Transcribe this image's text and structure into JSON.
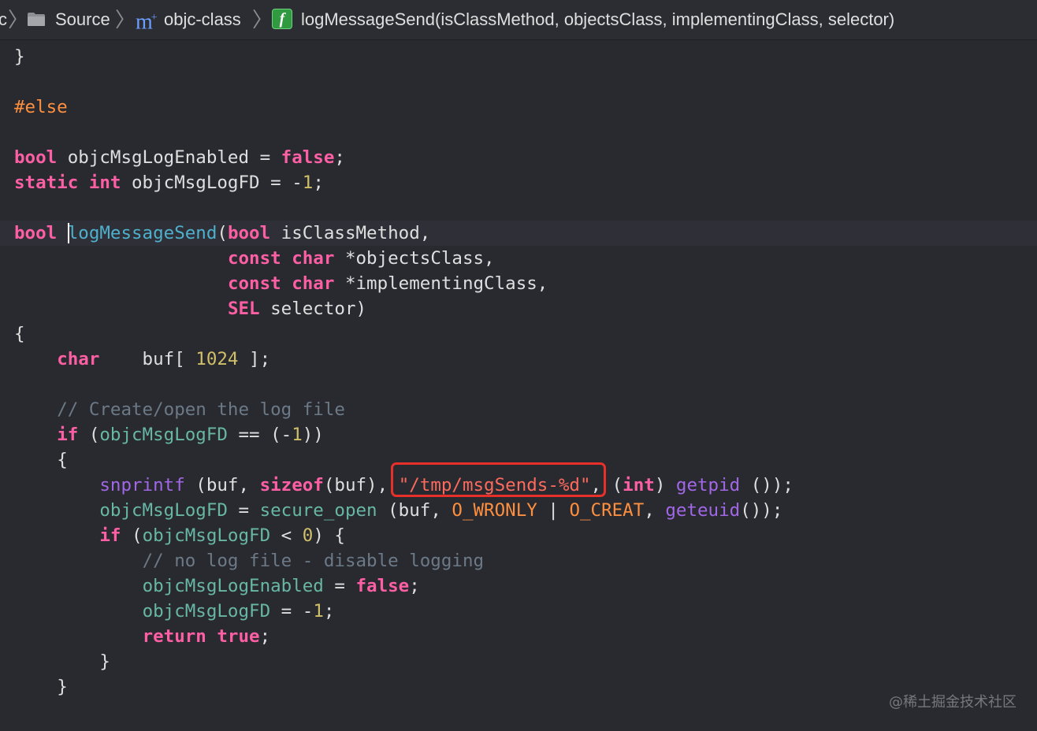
{
  "breadcrumb": {
    "partial_left": "c",
    "items": [
      {
        "label": "Source",
        "icon": "folder-icon"
      },
      {
        "label": "objc-class",
        "icon": "m-file-icon"
      },
      {
        "label": "logMessageSend(isClassMethod, objectsClass, implementingClass, selector)",
        "icon": "function-icon"
      }
    ],
    "chevron": "〉",
    "m_glyph": "m",
    "m_sup": "+",
    "f_glyph": "f"
  },
  "code": {
    "l1": "}",
    "l3": "#else",
    "l5": {
      "t1": "bool",
      "t2": " objcMsgLogEnabled = ",
      "t3": "false",
      "t4": ";"
    },
    "l6": {
      "t1": "static",
      "t2": " ",
      "t3": "int",
      "t4": " objcMsgLogFD = -",
      "t5": "1",
      "t6": ";"
    },
    "l8": {
      "t1": "bool",
      "t2": " ",
      "t3": "logMessageSend",
      "t4": "(",
      "t5": "bool",
      "t6": " isClassMethod,"
    },
    "l9": {
      "indent": "                    ",
      "t1": "const",
      "t2": " ",
      "t3": "char",
      "t4": " *objectsClass,"
    },
    "l10": {
      "indent": "                    ",
      "t1": "const",
      "t2": " ",
      "t3": "char",
      "t4": " *implementingClass,"
    },
    "l11": {
      "indent": "                    ",
      "t1": "SEL",
      "t2": " selector)"
    },
    "l12": "{",
    "l13": {
      "indent": "    ",
      "t1": "char",
      "t2": "    buf[ ",
      "t3": "1024",
      "t4": " ];"
    },
    "l15": {
      "indent": "    ",
      "t1": "// Create/open the log file"
    },
    "l16": {
      "indent": "    ",
      "t1": "if",
      "t2": " (",
      "t3": "objcMsgLogFD",
      "t4": " == (-",
      "t5": "1",
      "t6": "))"
    },
    "l17": {
      "indent": "    ",
      "t1": "{"
    },
    "l18": {
      "indent": "        ",
      "t1": "snprintf",
      "t2": " (buf, ",
      "t3": "sizeof",
      "t4": "(buf), ",
      "t5": "\"/tmp/msgSends-%d\"",
      "t6": ", (",
      "t7": "int",
      "t8": ") ",
      "t9": "getpid",
      "t10": " ());"
    },
    "l19": {
      "indent": "        ",
      "t1": "objcMsgLogFD",
      "t2": " = ",
      "t3": "secure_open",
      "t4": " (buf, ",
      "t5": "O_WRONLY",
      "t6": " | ",
      "t7": "O_CREAT",
      "t8": ", ",
      "t9": "geteuid",
      "t10": "());"
    },
    "l20": {
      "indent": "        ",
      "t1": "if",
      "t2": " (",
      "t3": "objcMsgLogFD",
      "t4": " < ",
      "t5": "0",
      "t6": ") {"
    },
    "l21": {
      "indent": "            ",
      "t1": "// no log file - disable logging"
    },
    "l22": {
      "indent": "            ",
      "t1": "objcMsgLogEnabled",
      "t2": " = ",
      "t3": "false",
      "t4": ";"
    },
    "l23": {
      "indent": "            ",
      "t1": "objcMsgLogFD",
      "t2": " = -",
      "t3": "1",
      "t4": ";"
    },
    "l24": {
      "indent": "            ",
      "t1": "return",
      "t2": " ",
      "t3": "true",
      "t4": ";"
    },
    "l25": {
      "indent": "        ",
      "t1": "}"
    },
    "l26": {
      "indent": "    ",
      "t1": "}"
    }
  },
  "watermark": "@稀土掘金技术社区",
  "colors": {
    "background": "#292a30",
    "keyword": "#fc5fa3",
    "preprocessor": "#fd8f3f",
    "number": "#d0bf69",
    "string": "#fc6a5d",
    "comment": "#6c7986",
    "function_decl": "#4eb0cc",
    "variable": "#67b7a4",
    "function_call": "#a167e6",
    "highlight_box": "#e8302a"
  }
}
